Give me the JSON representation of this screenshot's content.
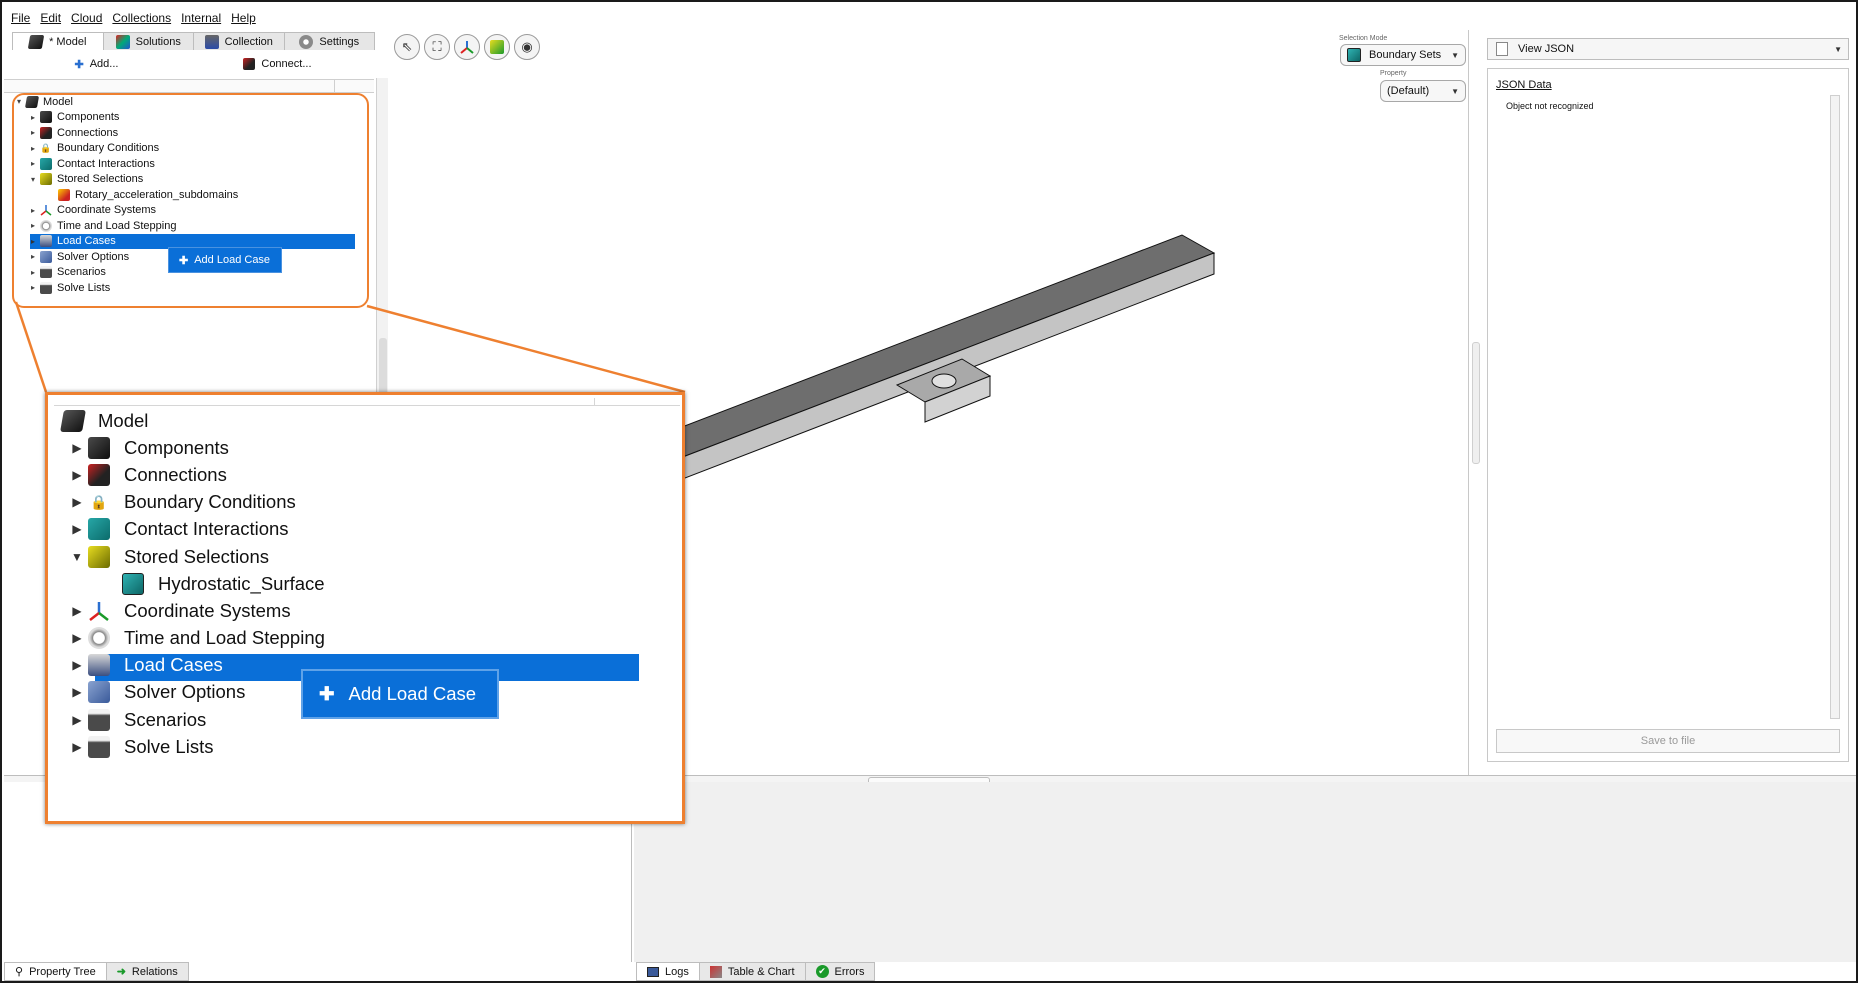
{
  "menubar": {
    "items": [
      {
        "label": "File"
      },
      {
        "label": "Edit"
      },
      {
        "label": "Cloud"
      },
      {
        "label": "Collections"
      },
      {
        "label": "Internal"
      },
      {
        "label": "Help"
      }
    ]
  },
  "left_tabs": [
    {
      "label": "* Model",
      "icon": "model-icon",
      "active": true
    },
    {
      "label": "Solutions",
      "icon": "solutions-icon",
      "active": false
    },
    {
      "label": "Collection",
      "icon": "collection-icon",
      "active": false
    },
    {
      "label": "Settings",
      "icon": "gear-icon",
      "active": false
    }
  ],
  "left_toolbar": {
    "add_label": "Add...",
    "connect_label": "Connect..."
  },
  "tree_small": {
    "root": "Model",
    "items": [
      {
        "label": "Components",
        "icon": "components-icon",
        "expanded": false
      },
      {
        "label": "Connections",
        "icon": "connections-icon",
        "expanded": false
      },
      {
        "label": "Boundary Conditions",
        "icon": "lock-icon",
        "expanded": false
      },
      {
        "label": "Contact Interactions",
        "icon": "contact-icon",
        "expanded": false
      },
      {
        "label": "Stored Selections",
        "icon": "stored-selections-icon",
        "expanded": true
      },
      {
        "label": "Rotary_acceleration_subdomains",
        "icon": "subdomain-icon",
        "child": true
      },
      {
        "label": "Coordinate Systems",
        "icon": "coordinate-icon",
        "expanded": false
      },
      {
        "label": "Time and Load Stepping",
        "icon": "clock-icon",
        "expanded": false
      },
      {
        "label": "Load Cases",
        "icon": "load-cases-icon",
        "expanded": false,
        "selected": true
      },
      {
        "label": "Solver Options",
        "icon": "solver-icon",
        "expanded": false
      },
      {
        "label": "Scenarios",
        "icon": "scenarios-icon",
        "expanded": false
      },
      {
        "label": "Solve Lists",
        "icon": "solve-lists-icon",
        "expanded": false
      }
    ],
    "context_menu": "Add Load Case"
  },
  "tree_zoom": {
    "root": "Model",
    "items": [
      {
        "label": "Components",
        "icon": "components-icon"
      },
      {
        "label": "Connections",
        "icon": "connections-icon"
      },
      {
        "label": "Boundary Conditions",
        "icon": "lock-icon"
      },
      {
        "label": "Contact Interactions",
        "icon": "contact-icon"
      },
      {
        "label": "Stored Selections",
        "icon": "stored-selections-icon",
        "expanded": true
      },
      {
        "label": "Hydrostatic_Surface",
        "icon": "boundary-set-icon",
        "child": true
      },
      {
        "label": "Coordinate Systems",
        "icon": "coordinate-icon"
      },
      {
        "label": "Time and Load Stepping",
        "icon": "clock-icon"
      },
      {
        "label": "Load Cases",
        "icon": "load-cases-icon",
        "selected": true
      },
      {
        "label": "Solver Options",
        "icon": "solver-icon"
      },
      {
        "label": "Scenarios",
        "icon": "scenarios-icon"
      },
      {
        "label": "Solve Lists",
        "icon": "solve-lists-icon"
      }
    ],
    "context_menu": "Add Load Case"
  },
  "viewport": {
    "tools": [
      "select-icon",
      "fit-view-icon",
      "axis-icon",
      "selection-filter-icon",
      "eye-icon"
    ],
    "selection_mode_label": "Selection Mode",
    "selection_mode_value": "Boundary Sets",
    "property_label": "Property",
    "property_value": "(Default)"
  },
  "right_panel": {
    "view_label": "View JSON",
    "json_title": "JSON Data",
    "json_message": "Object not recognized",
    "save_label": "Save to file"
  },
  "bottom_tabs_left": [
    {
      "label": "Property Tree",
      "icon": "search-icon",
      "active": true
    },
    {
      "label": "Relations",
      "icon": "arrow-right-icon",
      "active": false
    }
  ],
  "bottom_tabs_right": [
    {
      "label": "Logs",
      "icon": "logs-icon",
      "active": true
    },
    {
      "label": "Table & Chart",
      "icon": "table-icon",
      "active": false
    },
    {
      "label": "Errors",
      "icon": "check-icon",
      "active": false
    }
  ],
  "colors": {
    "selection": "#0a6fd8",
    "highlight_frame": "#ee8030"
  }
}
